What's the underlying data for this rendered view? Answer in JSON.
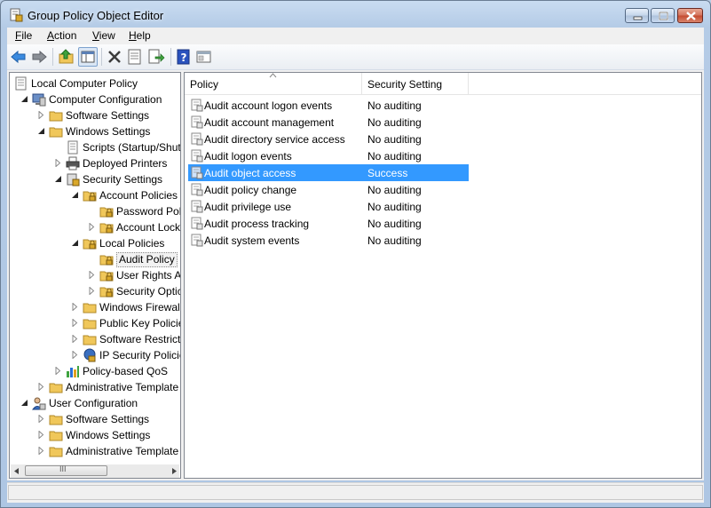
{
  "window": {
    "title": "Group Policy Object Editor"
  },
  "menu": {
    "items": [
      {
        "label": "File",
        "accel": "F",
        "rest": "ile"
      },
      {
        "label": "Action",
        "accel": "A",
        "rest": "ction"
      },
      {
        "label": "View",
        "accel": "V",
        "rest": "iew"
      },
      {
        "label": "Help",
        "accel": "H",
        "rest": "elp"
      }
    ]
  },
  "toolbar": {
    "buttons": [
      "back-icon",
      "forward-icon",
      "up-folder-icon",
      "show-hide-tree-icon",
      "delete-icon",
      "properties-icon",
      "export-list-icon",
      "help-icon",
      "console-icon"
    ]
  },
  "tree": {
    "items": [
      {
        "label": "Local Computer Policy",
        "icon": "policy-icon",
        "toggle": "none"
      },
      {
        "label": "Computer Configuration",
        "icon": "computer-icon",
        "toggle": "expanded"
      },
      {
        "label": "Software Settings",
        "icon": "folder-icon",
        "toggle": "collapsed"
      },
      {
        "label": "Windows Settings",
        "icon": "folder-icon",
        "toggle": "expanded"
      },
      {
        "label": "Scripts (Startup/Shut",
        "icon": "scripts-icon",
        "toggle": "none"
      },
      {
        "label": "Deployed Printers",
        "icon": "printer-icon",
        "toggle": "collapsed"
      },
      {
        "label": "Security Settings",
        "icon": "security-settings-icon",
        "toggle": "expanded"
      },
      {
        "label": "Account Policies",
        "icon": "locked-folder-icon",
        "toggle": "expanded"
      },
      {
        "label": "Password Pol",
        "icon": "locked-folder-icon",
        "toggle": "none"
      },
      {
        "label": "Account Lock",
        "icon": "locked-folder-icon",
        "toggle": "collapsed"
      },
      {
        "label": "Local Policies",
        "icon": "locked-folder-icon",
        "toggle": "expanded"
      },
      {
        "label": "Audit Policy",
        "icon": "locked-folder-icon",
        "toggle": "none"
      },
      {
        "label": "User Rights A",
        "icon": "locked-folder-icon",
        "toggle": "collapsed"
      },
      {
        "label": "Security Optic",
        "icon": "locked-folder-icon",
        "toggle": "collapsed"
      },
      {
        "label": "Windows Firewal",
        "icon": "folder-icon",
        "toggle": "collapsed"
      },
      {
        "label": "Public Key Policie",
        "icon": "folder-icon",
        "toggle": "collapsed"
      },
      {
        "label": "Software Restricti",
        "icon": "folder-icon",
        "toggle": "collapsed"
      },
      {
        "label": "IP Security Policie",
        "icon": "ip-security-icon",
        "toggle": "collapsed"
      },
      {
        "label": "Policy-based QoS",
        "icon": "qos-chart-icon",
        "toggle": "collapsed"
      },
      {
        "label": "Administrative Template",
        "icon": "folder-icon",
        "toggle": "collapsed"
      },
      {
        "label": "User Configuration",
        "icon": "user-icon",
        "toggle": "expanded"
      },
      {
        "label": "Software Settings",
        "icon": "folder-icon",
        "toggle": "collapsed"
      },
      {
        "label": "Windows Settings",
        "icon": "folder-icon",
        "toggle": "collapsed"
      },
      {
        "label": "Administrative Template",
        "icon": "folder-icon",
        "toggle": "collapsed"
      }
    ]
  },
  "list": {
    "columns": [
      "Policy",
      "Security Setting"
    ],
    "rows": [
      {
        "policy": "Audit account logon events",
        "setting": "No auditing",
        "selected": false
      },
      {
        "policy": "Audit account management",
        "setting": "No auditing",
        "selected": false
      },
      {
        "policy": "Audit directory service access",
        "setting": "No auditing",
        "selected": false
      },
      {
        "policy": "Audit logon events",
        "setting": "No auditing",
        "selected": false
      },
      {
        "policy": "Audit object access",
        "setting": "Success",
        "selected": true
      },
      {
        "policy": "Audit policy change",
        "setting": "No auditing",
        "selected": false
      },
      {
        "policy": "Audit privilege use",
        "setting": "No auditing",
        "selected": false
      },
      {
        "policy": "Audit process tracking",
        "setting": "No auditing",
        "selected": false
      },
      {
        "policy": "Audit system events",
        "setting": "No auditing",
        "selected": false
      }
    ]
  },
  "scroll": {
    "grip": "III"
  },
  "colors": {
    "selection": "#3399ff",
    "folder": "#f0c75a"
  }
}
